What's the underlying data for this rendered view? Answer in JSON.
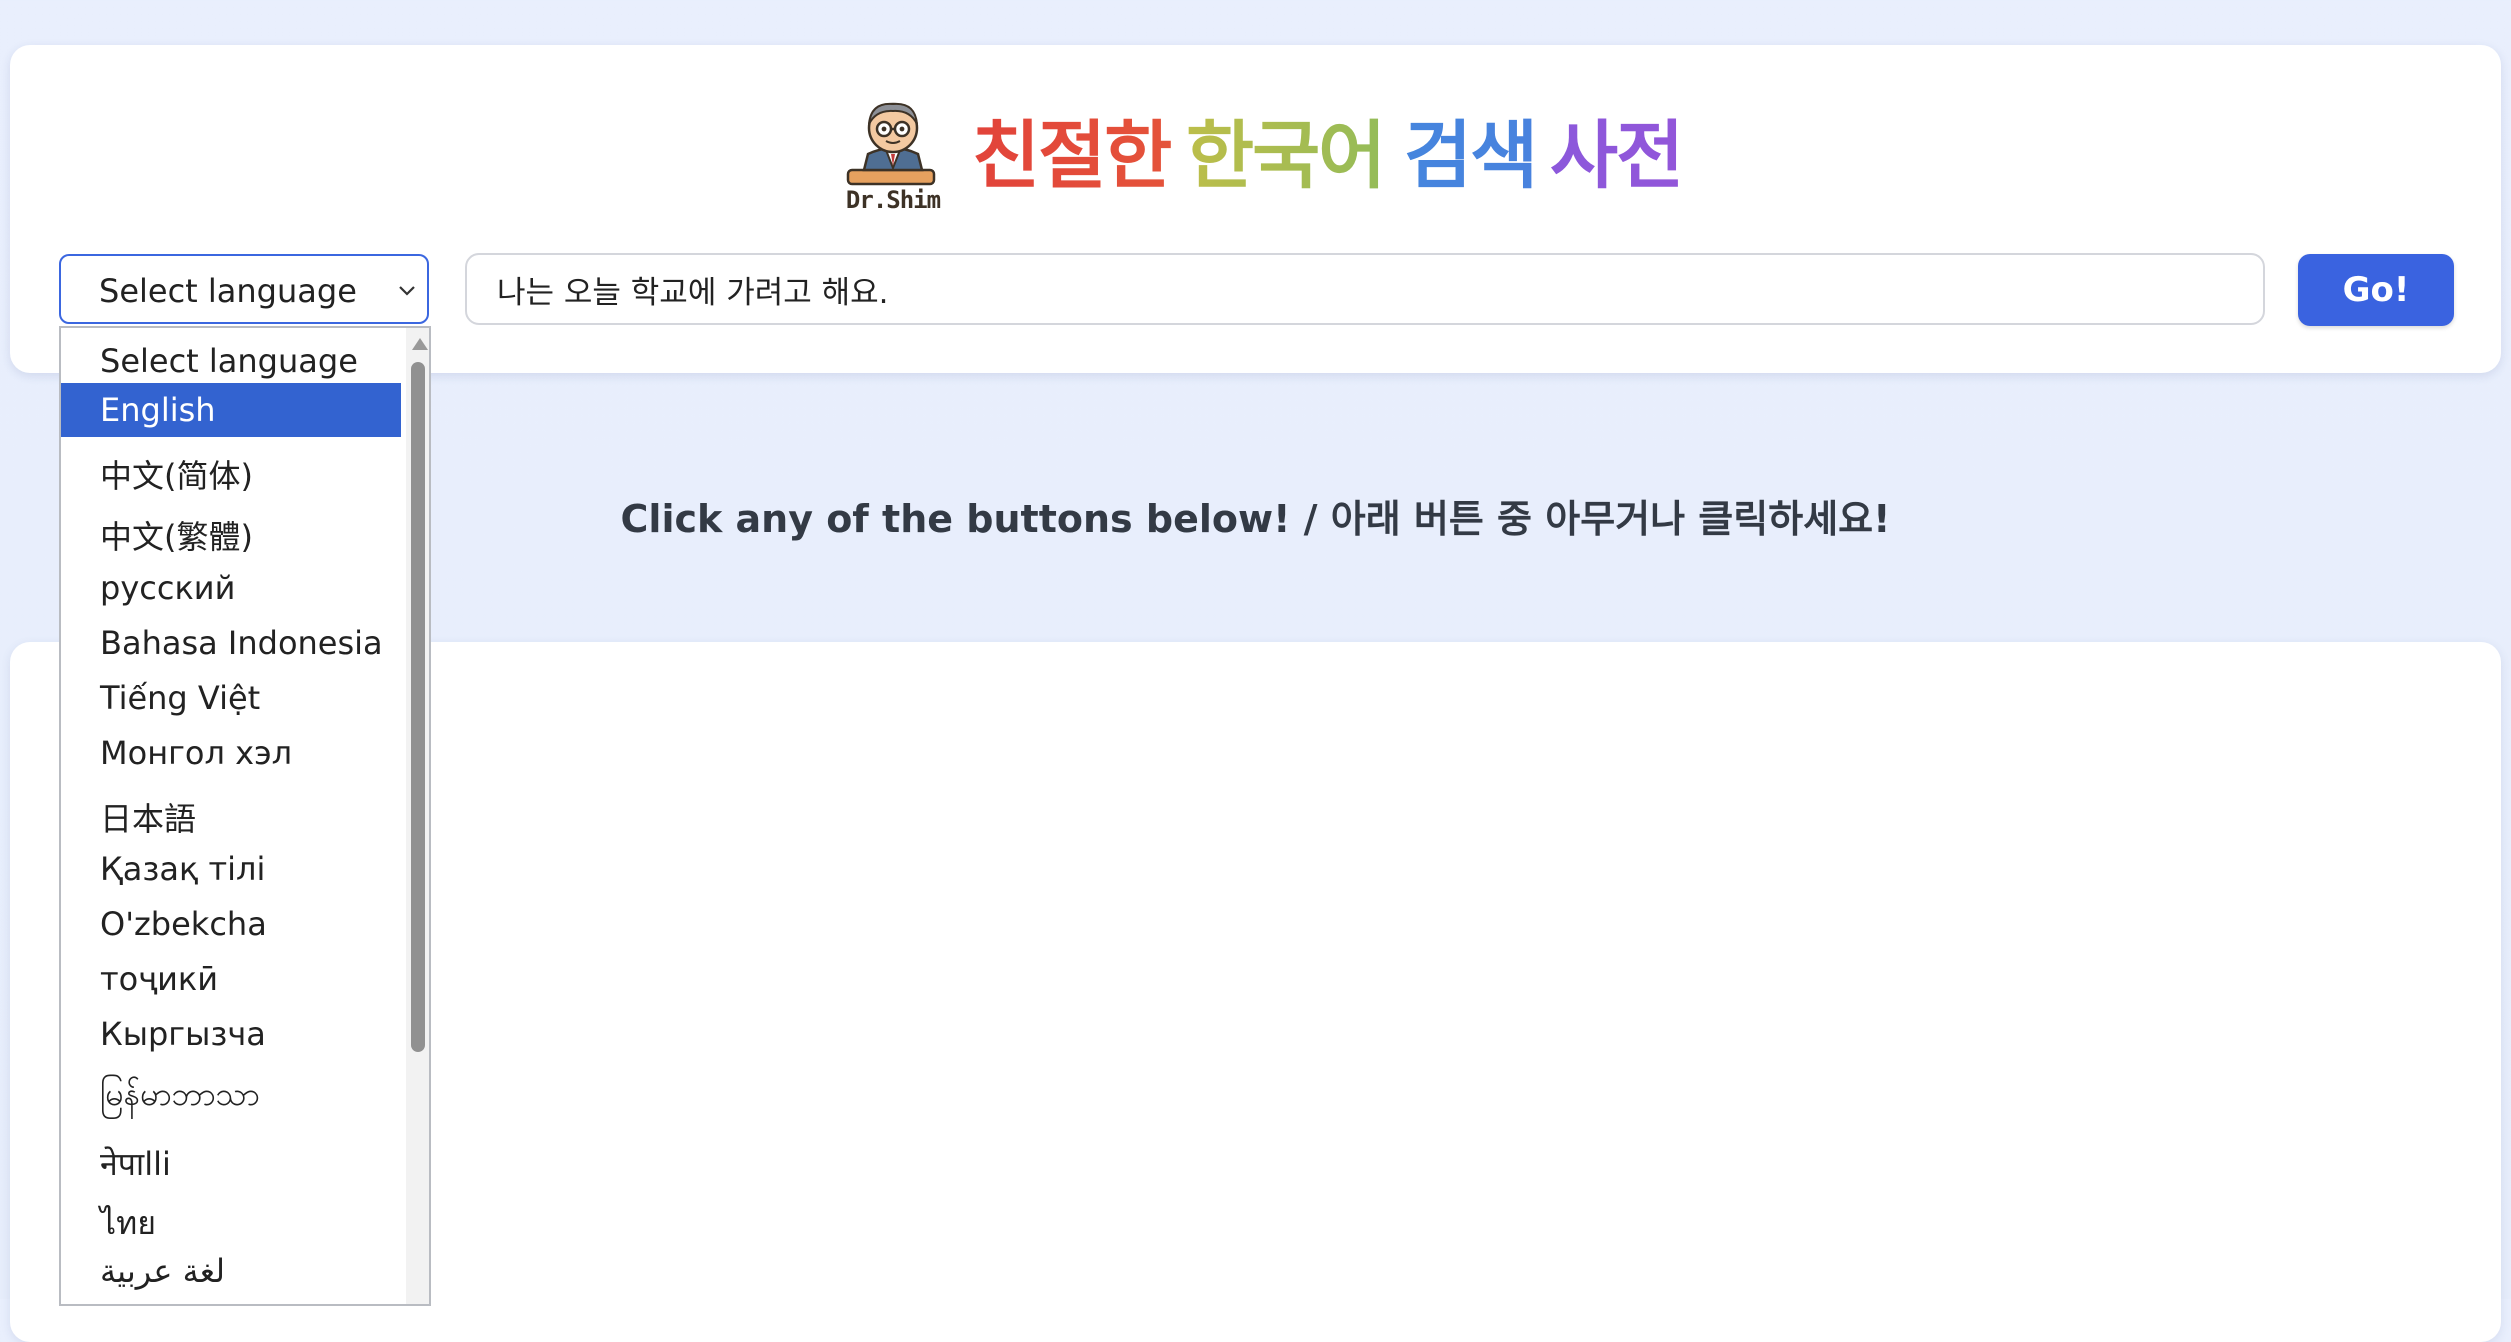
{
  "header": {
    "logo_text": "Dr.Shim",
    "title_words": [
      {
        "text": "친절한",
        "colors": [
          "#e2433a",
          "#ea7d3b"
        ]
      },
      {
        "text": "한국어",
        "colors": [
          "#e8c03a",
          "#57b86e"
        ]
      },
      {
        "text": "검색",
        "colors": [
          "#3f8fd9",
          "#4a7fe0"
        ]
      },
      {
        "text": "사전",
        "colors": [
          "#6f62e6",
          "#9256d9"
        ]
      }
    ]
  },
  "search": {
    "select_label": "Select language",
    "input_value": "나는 오늘 학교에 가려고 해요.",
    "go_label": "Go!"
  },
  "instruction": "Click any of the buttons below! / 아래 버튼 중 아무거나 클릭하세요!",
  "dropdown": {
    "selected_index": 1,
    "options": [
      "Select language",
      "English",
      "中文(简体)",
      "中文(繁體)",
      "русский",
      "Bahasa Indonesia",
      "Tiếng Việt",
      "Монгол хэл",
      "日本語",
      "Қазақ тілі",
      "O'zbekcha",
      "тоҷикӣ",
      "Кыргызча",
      "မြန်မာဘာသာ",
      "नेपाlli",
      "ไทย",
      "لغة عربية"
    ]
  },
  "colors": {
    "accent": "#3a63e0",
    "selected_option": "#3363d0",
    "background": "#e9effd"
  }
}
